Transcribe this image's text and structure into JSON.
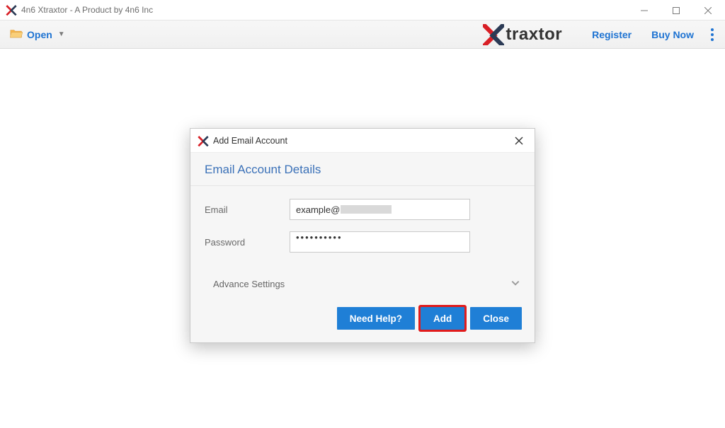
{
  "window": {
    "title": "4n6 Xtraxtor - A Product by 4n6 Inc"
  },
  "toolbar": {
    "open_label": "Open",
    "brand_text": "traxtor",
    "register_label": "Register",
    "buy_now_label": "Buy Now"
  },
  "dialog": {
    "title": "Add Email Account",
    "section_title": "Email Account Details",
    "email_label": "Email",
    "email_value_prefix": "example@",
    "password_label": "Password",
    "password_value": "••••••••••",
    "advance_label": "Advance Settings",
    "need_help_label": "Need Help?",
    "add_label": "Add",
    "close_label": "Close"
  }
}
